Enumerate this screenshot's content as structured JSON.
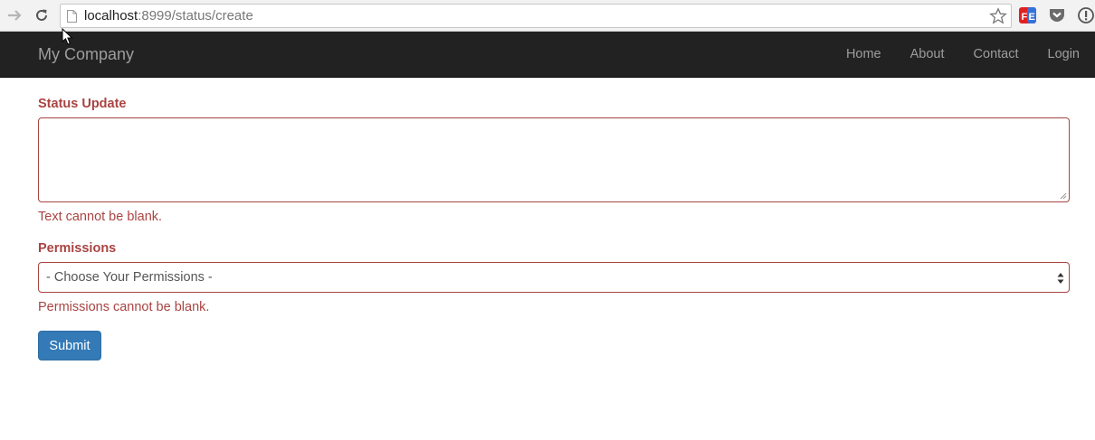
{
  "browser": {
    "url_host": "localhost",
    "url_path": ":8999/status/create"
  },
  "navbar": {
    "brand": "My Company",
    "links": [
      {
        "label": "Home"
      },
      {
        "label": "About"
      },
      {
        "label": "Contact"
      },
      {
        "label": "Login"
      }
    ]
  },
  "form": {
    "status_label": "Status Update",
    "status_value": "",
    "status_error": "Text cannot be blank.",
    "permissions_label": "Permissions",
    "permissions_selected": "- Choose Your Permissions -",
    "permissions_error": "Permissions cannot be blank.",
    "submit_label": "Submit"
  },
  "colors": {
    "error": "#a94442",
    "primary_button": "#337ab7",
    "navbar_bg": "#222222",
    "navbar_text": "#9d9d9d"
  },
  "icons": [
    "forward-icon",
    "reload-icon",
    "page-icon",
    "star-icon",
    "feedly-icon",
    "pocket-icon",
    "info-icon",
    "cursor-icon"
  ]
}
